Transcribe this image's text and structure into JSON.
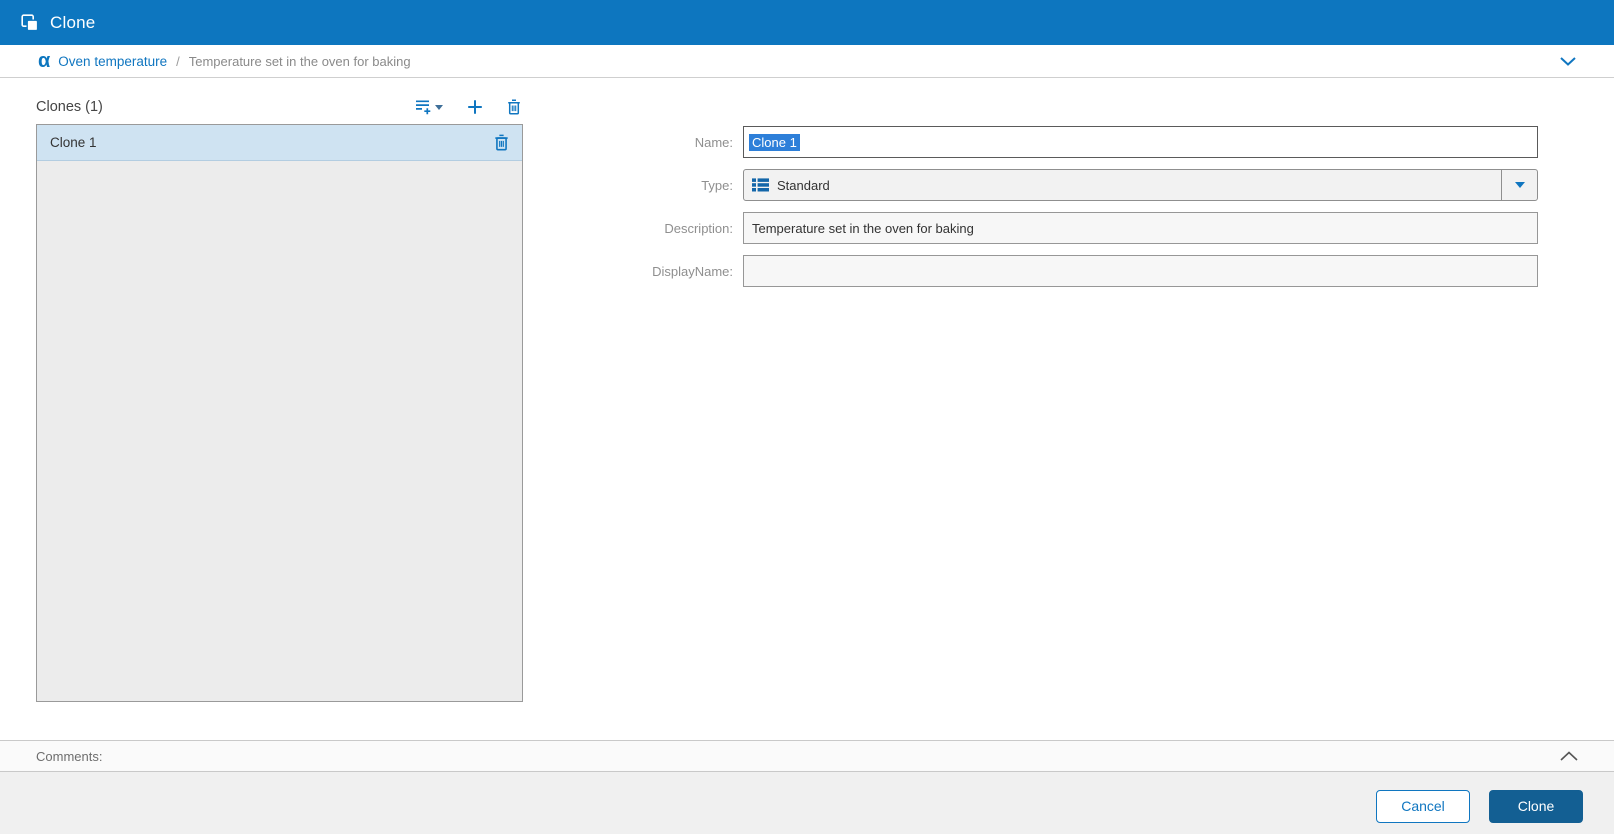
{
  "colors": {
    "titlebar_bg": "#0d76bf",
    "accent_blue": "#1076c0",
    "primary_button_bg": "#135f93",
    "selected_row_bg": "#cfe3f2",
    "panel_bg": "#ececec",
    "text_selection_highlight": "#2d7fd9"
  },
  "title_bar": {
    "title": "Clone",
    "icon": "clone-icon"
  },
  "breadcrumb": {
    "root_icon": "alpha-icon",
    "root_label": "Oven temperature",
    "separator": "/",
    "current_label": "Temperature set in the oven for baking",
    "collapse_icon": "chevron-down-icon"
  },
  "clones_panel": {
    "header": "Clones (1)",
    "toolbar_icons": [
      "add-items-icon",
      "plus-icon",
      "trash-icon"
    ],
    "items": [
      {
        "name": "Clone 1",
        "selected": true,
        "row_icon": "trash-icon"
      }
    ]
  },
  "form": {
    "name_label": "Name:",
    "name_value": "Clone 1",
    "type_label": "Type:",
    "type_value": "Standard",
    "type_icon": "standard-type-icon",
    "description_label": "Description:",
    "description_value": "Temperature set in the oven for baking",
    "displayname_label": "DisplayName:",
    "displayname_value": ""
  },
  "comments": {
    "label": "Comments:",
    "collapse_icon": "chevron-up-icon"
  },
  "footer": {
    "cancel_label": "Cancel",
    "clone_label": "Clone"
  }
}
